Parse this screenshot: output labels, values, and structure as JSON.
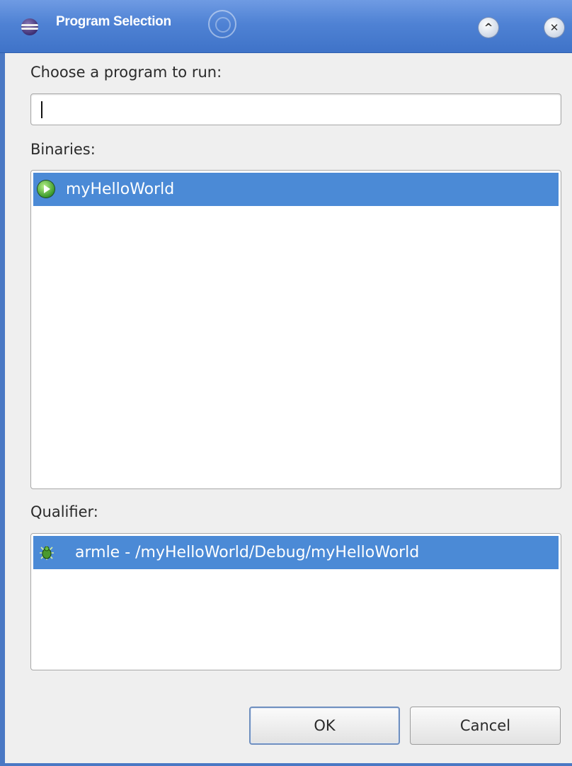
{
  "window": {
    "title": "Program Selection"
  },
  "titlebar_buttons": {
    "shade_symbol": "^",
    "close_symbol": "✕"
  },
  "dialog": {
    "prompt_label": "Choose a program to run:",
    "program_input_value": "",
    "binaries_label": "Binaries:",
    "binaries": [
      {
        "label": "myHelloWorld",
        "icon": "executable-icon",
        "selected": true
      }
    ],
    "qualifier_label": "Qualifier:",
    "qualifiers": [
      {
        "label": "armle - /myHelloWorld/Debug/myHelloWorld",
        "icon": "bug-icon",
        "selected": true
      }
    ]
  },
  "buttons": {
    "ok_label": "OK",
    "cancel_label": "Cancel"
  },
  "colors": {
    "titlebar": "#4f82d4",
    "selection": "#4b8ad6",
    "window_border": "#4a78c4",
    "dialog_background": "#efefef"
  }
}
